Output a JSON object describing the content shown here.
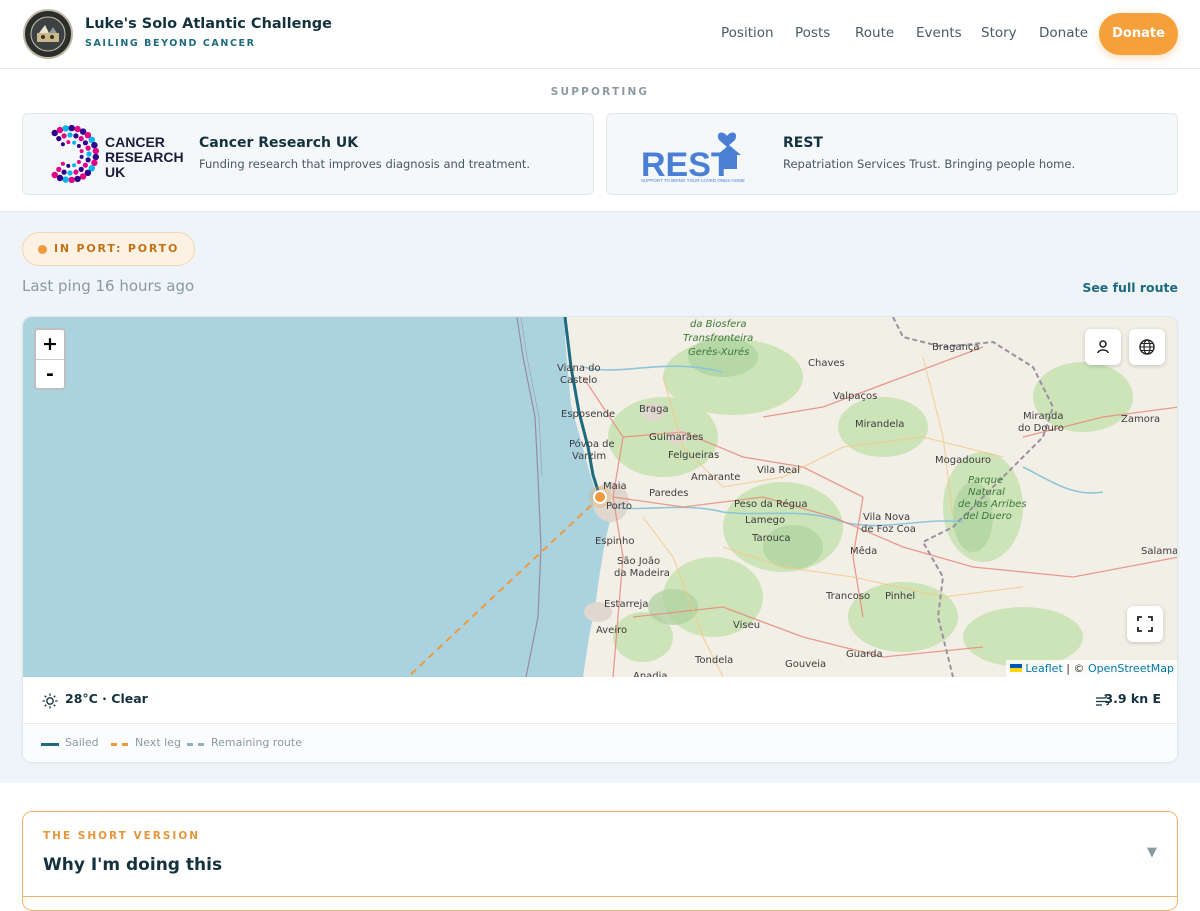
{
  "header": {
    "title": "Luke's Solo Atlantic Challenge",
    "subtitle": "SAILING BEYOND CANCER",
    "nav": [
      "Position",
      "Posts",
      "Route",
      "Events",
      "Story",
      "Donate"
    ],
    "donate_button": "Donate",
    "accent_color": "#f5a03a"
  },
  "supporting": {
    "label": "SUPPORTING",
    "charities": [
      {
        "logo_text": [
          "CANCER",
          "RESEARCH",
          "UK"
        ],
        "name": "Cancer Research UK",
        "description": "Funding research that improves diagnosis and treatment."
      },
      {
        "logo_text": "REST",
        "logo_tagline": "SUPPORT TO BRING YOUR LOVED ONES HOME",
        "name": "REST",
        "description": "Repatriation Services Trust. Bringing people home."
      }
    ]
  },
  "status": {
    "badge": "IN PORT: PORTO",
    "last_ping": "Last ping 16 hours ago",
    "full_route_link": "See full route"
  },
  "map": {
    "zoom_in": "+",
    "zoom_out": "-",
    "place_labels": [
      "da Biosfera",
      "Transfronteira",
      "Gerês-Xurés",
      "Chaves",
      "Bragança",
      "Viana do",
      "Castelo",
      "Esposende",
      "Braga",
      "Valpaços",
      "Póvoa de",
      "Varzim",
      "Guimarães",
      "Mirandela",
      "Miranda",
      "do Douro",
      "Zamora",
      "Felgueiras",
      "Vila Real",
      "Mogadouro",
      "Maia",
      "Paredes",
      "Amarante",
      "Parque",
      "Natural",
      "de las Arribes",
      "del Duero",
      "Porto",
      "Peso da Régua",
      "Lamego",
      "Vila Nova",
      "de Foz Coa",
      "Espinho",
      "Tarouca",
      "Mêda",
      "Salamanca",
      "São João",
      "da Madeira",
      "Trancoso",
      "Pinhel",
      "Estarreja",
      "Aveiro",
      "Viseu",
      "Guarda",
      "Tondela",
      "Gouveia",
      "Anadia"
    ],
    "attribution": {
      "leaflet": "Leaflet",
      "separator": " | © ",
      "osm": "OpenStreetMap"
    },
    "controls": [
      "person-icon",
      "globe-icon",
      "fullscreen-icon"
    ]
  },
  "conditions": {
    "weather": "28°C · Clear",
    "wind": "3.9 kn E"
  },
  "legend": [
    {
      "label": "Sailed",
      "color": "#1c6b80"
    },
    {
      "label": "Next leg",
      "color": "#ee9a3c"
    },
    {
      "label": "Remaining route",
      "color": "#8fb0bd"
    }
  ],
  "short_version": {
    "eyebrow": "THE SHORT VERSION",
    "title": "Why I'm doing this",
    "chevron": "▼"
  }
}
